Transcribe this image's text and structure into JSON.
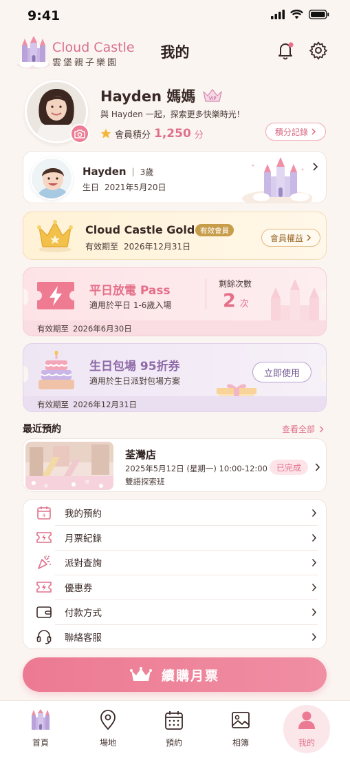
{
  "status_bar": {
    "time": "9:41"
  },
  "header": {
    "logo_en": "Cloud Castle",
    "logo_zh": "雲堡親子樂園",
    "title": "我的"
  },
  "profile": {
    "name": "Hayden 媽媽",
    "vip_badge": "VIP",
    "tagline": "與 Hayden 一起，探索更多快樂時光！",
    "points_label": "會員積分",
    "points_value": "1,250",
    "points_unit": "分",
    "points_history_button": "積分記錄"
  },
  "child": {
    "name": "Hayden",
    "separator": "|",
    "age": "3歲",
    "birthday_label": "生日",
    "birthday": "2021年5月20日"
  },
  "membership": {
    "tier": "Cloud Castle Gold",
    "status_badge": "有效會員",
    "expiry_label": "有效期至",
    "expiry": "2026年12月31日",
    "benefits_button": "會員權益"
  },
  "pass": {
    "title": "平日放電 Pass",
    "subtitle": "適用於平日 1-6歲入場",
    "remaining_label": "剩餘次數",
    "remaining_value": "2",
    "remaining_unit": "次",
    "expiry_label": "有效期至",
    "expiry": "2026年6月30日"
  },
  "coupon": {
    "title": "生日包場 95折券",
    "subtitle": "適用於生日派對包場方案",
    "use_button": "立即使用",
    "expiry_label": "有效期至",
    "expiry": "2026年12月31日"
  },
  "recent": {
    "section_title": "最近預約",
    "see_all": "查看全部",
    "booking": {
      "store": "荃灣店",
      "datetime": "2025年5月12日 (星期一) 10:00-12:00",
      "class_name": "雙語探索班",
      "status": "已完成"
    }
  },
  "menu": [
    {
      "label": "我的預約",
      "icon": "calendar-icon"
    },
    {
      "label": "月票紀錄",
      "icon": "ticket-icon"
    },
    {
      "label": "派對查詢",
      "icon": "party-popper-icon"
    },
    {
      "label": "優惠券",
      "icon": "coupon-icon"
    },
    {
      "label": "付款方式",
      "icon": "wallet-icon"
    },
    {
      "label": "聯絡客服",
      "icon": "headset-icon"
    }
  ],
  "cta": {
    "label": "續購月票"
  },
  "tabbar": {
    "items": [
      {
        "label": "首頁",
        "icon": "castle-icon"
      },
      {
        "label": "場地",
        "icon": "location-pin-icon"
      },
      {
        "label": "預約",
        "icon": "calendar-icon"
      },
      {
        "label": "相簿",
        "icon": "photo-icon"
      },
      {
        "label": "我的",
        "icon": "user-icon"
      }
    ],
    "active_index": 4
  },
  "colors": {
    "accent": "#e0708a",
    "background": "#fbf5f1",
    "gold": "#f0c24a"
  }
}
